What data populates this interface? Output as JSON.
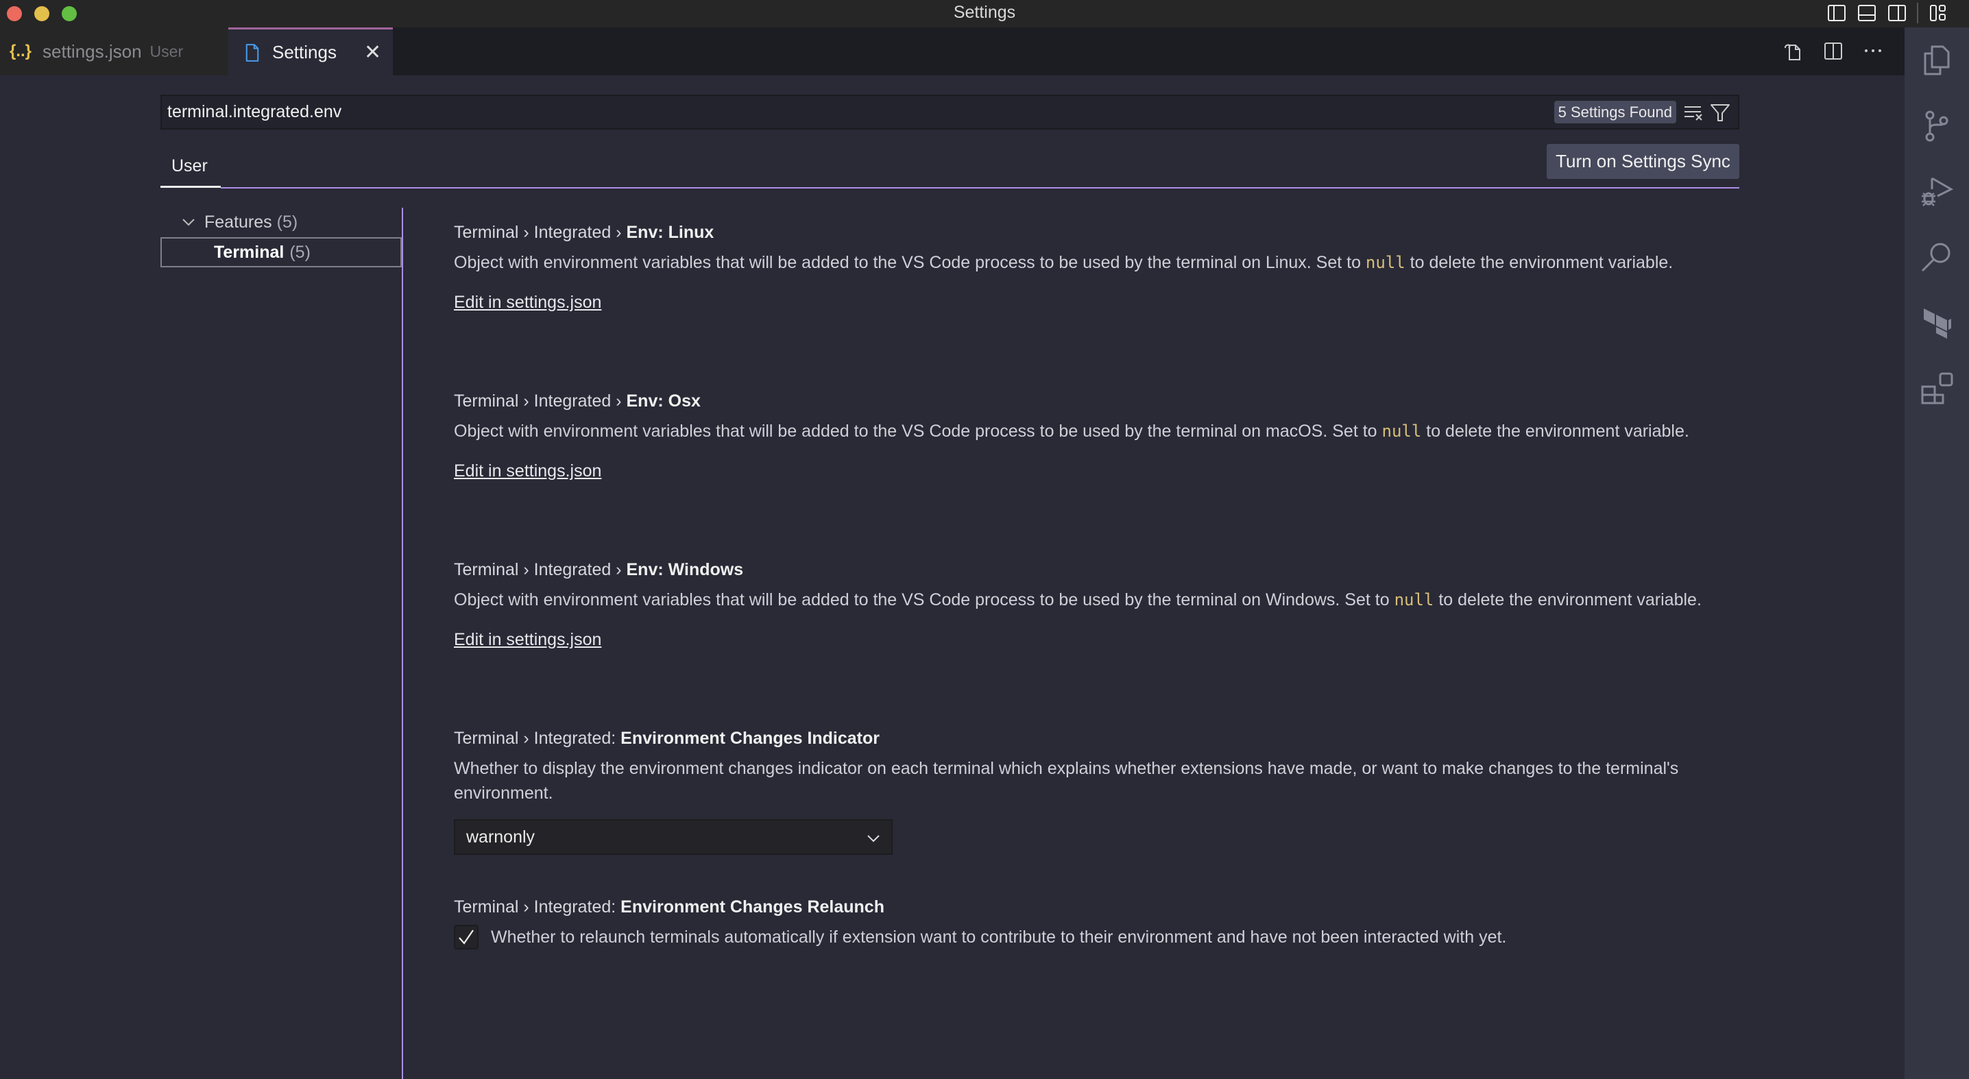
{
  "window": {
    "title": "Settings"
  },
  "tabs": [
    {
      "label": "settings.json",
      "description": "User",
      "icon": "json-braces-icon",
      "active": false
    },
    {
      "label": "Settings",
      "icon": "file-icon",
      "active": true
    }
  ],
  "search": {
    "value": "terminal.integrated.env",
    "placeholder": "Search settings",
    "results_badge": "5 Settings Found"
  },
  "scope_tabs": [
    {
      "label": "User",
      "active": true
    }
  ],
  "sync_button": "Turn on Settings Sync",
  "toc": {
    "group": {
      "label": "Features",
      "count": "(5)"
    },
    "item": {
      "label": "Terminal",
      "count": "(5)"
    }
  },
  "settings": [
    {
      "category": "Terminal › Integrated › ",
      "key": "Env: Linux",
      "description_before": "Object with environment variables that will be added to the VS Code process to be used by the terminal on Linux. Set to ",
      "code": "null",
      "description_after": " to delete the environment variable.",
      "link": "Edit in settings.json"
    },
    {
      "category": "Terminal › Integrated › ",
      "key": "Env: Osx",
      "description_before": "Object with environment variables that will be added to the VS Code process to be used by the terminal on macOS. Set to ",
      "code": "null",
      "description_after": " to delete the environment variable.",
      "link": "Edit in settings.json"
    },
    {
      "category": "Terminal › Integrated › ",
      "key": "Env: Windows",
      "description_before": "Object with environment variables that will be added to the VS Code process to be used by the terminal on Windows. Set to ",
      "code": "null",
      "description_after": " to delete the environment variable.",
      "link": "Edit in settings.json"
    },
    {
      "category": "Terminal › Integrated: ",
      "key": "Environment Changes Indicator",
      "description": "Whether to display the environment changes indicator on each terminal which explains whether extensions have made, or want to make changes to the terminal's environment.",
      "value": "warnonly"
    },
    {
      "category": "Terminal › Integrated: ",
      "key": "Environment Changes Relaunch",
      "description": "Whether to relaunch terminals automatically if extension want to contribute to their environment and have not been interacted with yet.",
      "checked": true
    }
  ],
  "colors": {
    "accent": "#ad8ee6",
    "tab_active_border": "#a0649c",
    "code_null": "#d8bd7a",
    "json_icon": "#e8c04f",
    "file_icon": "#4a9be8"
  }
}
